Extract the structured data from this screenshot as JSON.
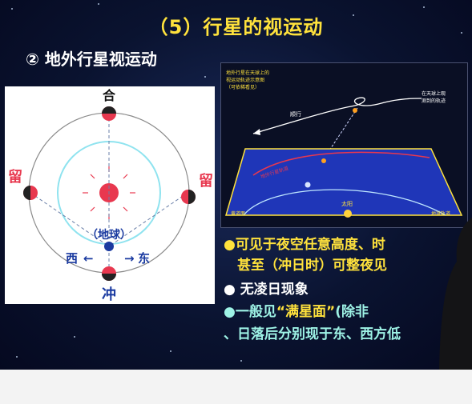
{
  "slide": {
    "title": "（5）行星的视运动",
    "subtitle": "② 地外行星视运动"
  },
  "left_diagram": {
    "label_he": "合",
    "label_liu_left": "留",
    "label_liu_right": "留",
    "label_earth": "（地球）",
    "label_west": "西",
    "label_east": "东",
    "label_chong": "冲",
    "arrow_left": "←",
    "arrow_right": "→"
  },
  "right_diagram": {
    "caption_1": "地外行星在天球上的",
    "caption_2": "视运动轨迹示意图",
    "caption_3": "（可依稀看见）",
    "caption_right_1": "在天球上观",
    "caption_right_2": "测到的轨迹",
    "label_shunxing": "顺行",
    "label_orbit": "地外行星轨道",
    "label_sun": "太阳",
    "label_ecliptic": "黄道面",
    "label_earth_orbit": "地球轨道"
  },
  "notes": {
    "line1": "●可见于夜空任意高度、时",
    "line2": "　甚至（冲日时）可整夜见",
    "line3": "● 无凌日现象",
    "line4_a": "●一般见",
    "line4_b": "“满星面”",
    "line4_c": "(除非",
    "line5": "、日落后分别现于东、西方低"
  }
}
